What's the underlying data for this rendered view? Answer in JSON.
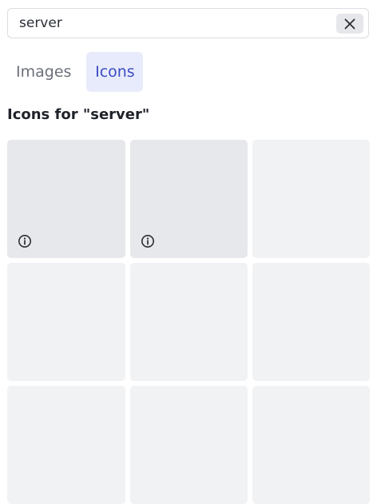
{
  "search": {
    "value": "server",
    "placeholder": ""
  },
  "clear_icon": "close-icon",
  "tabs": [
    {
      "label": "Images",
      "active": false
    },
    {
      "label": "Icons",
      "active": true
    }
  ],
  "results": {
    "title": "Icons for \"server\""
  },
  "colors": {
    "active_tab_bg": "#e8ebfb",
    "active_tab_text": "#3a4cc4",
    "tile_bg": "#f1f2f4"
  },
  "info_icon": "info-icon"
}
